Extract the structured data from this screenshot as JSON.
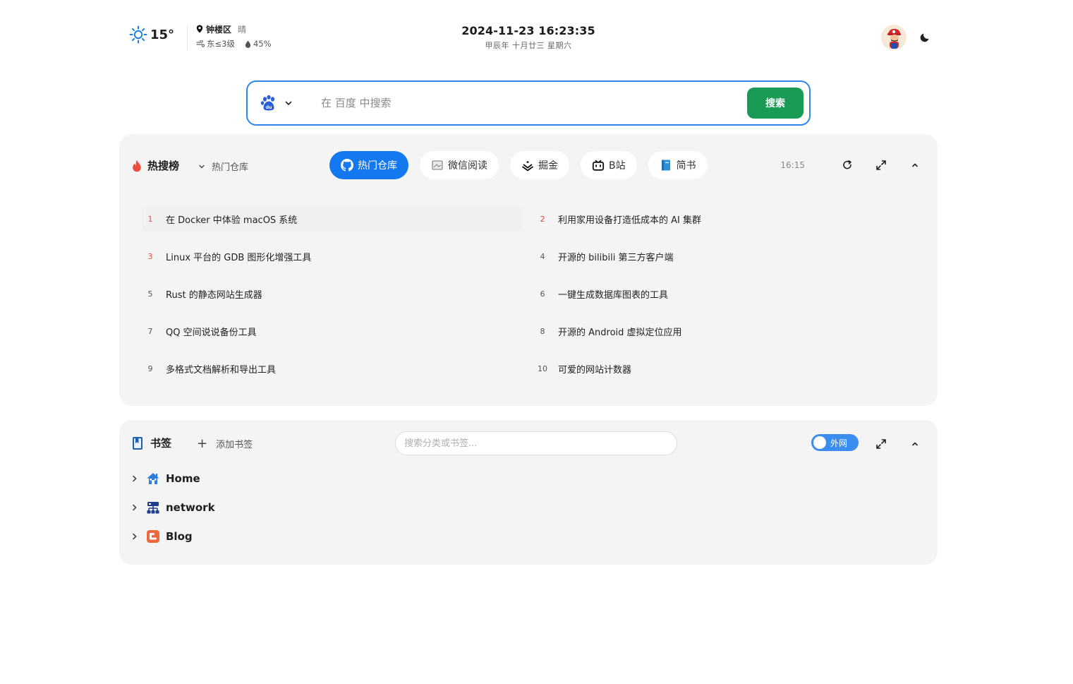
{
  "weather": {
    "temperature": "15°",
    "location": "钟楼区",
    "condition": "晴",
    "wind": "东≤3级",
    "humidity": "45%"
  },
  "clock": {
    "datetime": "2024-11-23 16:23:35",
    "lunar": "甲辰年 十月廿三 星期六"
  },
  "search": {
    "placeholder": "在 百度 中搜索",
    "button_label": "搜索",
    "engine_icon": "baidu-paw-icon"
  },
  "hot": {
    "title": "热搜榜",
    "dropdown_label": "热门仓库",
    "tabs": [
      {
        "label": "热门仓库",
        "icon": "github-icon",
        "active": true
      },
      {
        "label": "微信阅读",
        "icon": "wechat-read-icon",
        "active": false
      },
      {
        "label": "掘金",
        "icon": "juejin-icon",
        "active": false
      },
      {
        "label": "B站",
        "icon": "bilibili-icon",
        "active": false
      },
      {
        "label": "简书",
        "icon": "jianshu-icon",
        "active": false
      }
    ],
    "updated_time": "16:15",
    "items": [
      {
        "rank": "1",
        "title": "在 Docker 中体验 macOS 系统"
      },
      {
        "rank": "2",
        "title": "利用家用设备打造低成本的 AI 集群"
      },
      {
        "rank": "3",
        "title": "Linux 平台的 GDB 图形化增强工具"
      },
      {
        "rank": "4",
        "title": "开源的 bilibili 第三方客户端"
      },
      {
        "rank": "5",
        "title": "Rust 的静态网站生成器"
      },
      {
        "rank": "6",
        "title": "一键生成数据库图表的工具"
      },
      {
        "rank": "7",
        "title": "QQ 空间说说备份工具"
      },
      {
        "rank": "8",
        "title": "开源的 Android 虚拟定位应用"
      },
      {
        "rank": "9",
        "title": "多格式文档解析和导出工具"
      },
      {
        "rank": "10",
        "title": "可爱的网站计数器"
      }
    ]
  },
  "bookmarks": {
    "title": "书签",
    "add_label": "添加书签",
    "search_placeholder": "搜索分类或书签...",
    "toggle_label": "外网",
    "folders": [
      {
        "name": "Home",
        "icon": "home-icon"
      },
      {
        "name": "network",
        "icon": "network-icon"
      },
      {
        "name": "Blog",
        "icon": "blogger-icon"
      }
    ]
  },
  "colors": {
    "accent_blue": "#1478f0",
    "search_border": "#2d86e8",
    "search_button": "#1a9b55",
    "rank_red": "#e84a3c",
    "panel_bg": "#f4f4f4"
  }
}
